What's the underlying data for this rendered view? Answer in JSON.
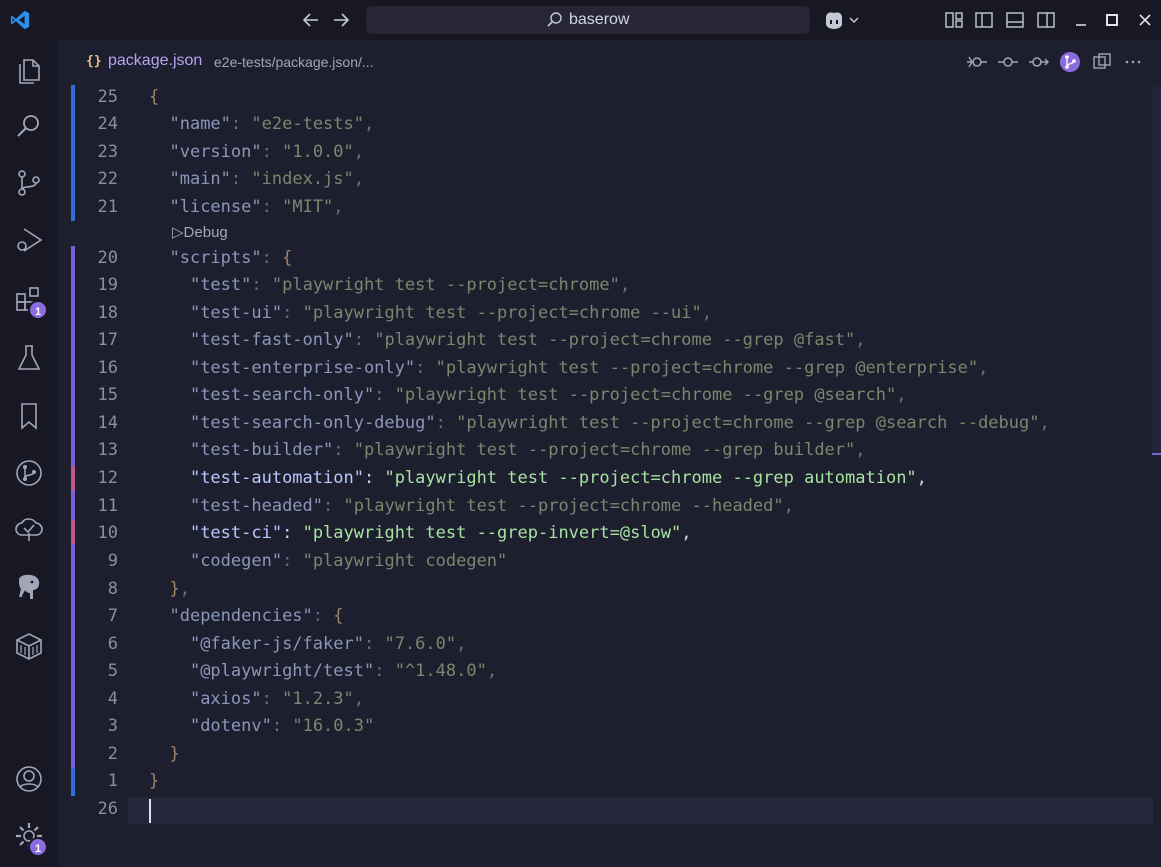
{
  "titlebar": {
    "search_text": "baserow"
  },
  "activity_bar": {
    "extensions_badge": "1",
    "settings_badge": "1"
  },
  "tab": {
    "icon_text": "{}",
    "filename": "package.json",
    "path": "e2e-tests/package.json/..."
  },
  "editor": {
    "codelens": "Debug",
    "lines": [
      {
        "n": "25",
        "t": "{"
      },
      {
        "n": "24",
        "t": "  \"name\": \"e2e-tests\","
      },
      {
        "n": "23",
        "t": "  \"version\": \"1.0.0\","
      },
      {
        "n": "22",
        "t": "  \"main\": \"index.js\","
      },
      {
        "n": "21",
        "t": "  \"license\": \"MIT\","
      },
      {
        "n": "20",
        "t": "  \"scripts\": {"
      },
      {
        "n": "19",
        "t": "    \"test\": \"playwright test --project=chrome\","
      },
      {
        "n": "18",
        "t": "    \"test-ui\": \"playwright test --project=chrome --ui\","
      },
      {
        "n": "17",
        "t": "    \"test-fast-only\": \"playwright test --project=chrome --grep @fast\","
      },
      {
        "n": "16",
        "t": "    \"test-enterprise-only\": \"playwright test --project=chrome --grep @enterprise\","
      },
      {
        "n": "15",
        "t": "    \"test-search-only\": \"playwright test --project=chrome --grep @search\","
      },
      {
        "n": "14",
        "t": "    \"test-search-only-debug\": \"playwright test --project=chrome --grep @search --debug\","
      },
      {
        "n": "13",
        "t": "    \"test-builder\": \"playwright test --project=chrome --grep builder\","
      },
      {
        "n": "12",
        "t": "    \"test-automation\": \"playwright test --project=chrome --grep automation\","
      },
      {
        "n": "11",
        "t": "    \"test-headed\": \"playwright test --project=chrome --headed\","
      },
      {
        "n": "10",
        "t": "    \"test-ci\": \"playwright test --grep-invert=@slow\","
      },
      {
        "n": "9",
        "t": "    \"codegen\": \"playwright codegen\""
      },
      {
        "n": "8",
        "t": "  },"
      },
      {
        "n": "7",
        "t": "  \"dependencies\": {"
      },
      {
        "n": "6",
        "t": "    \"@faker-js/faker\": \"7.6.0\","
      },
      {
        "n": "5",
        "t": "    \"@playwright/test\": \"^1.48.0\","
      },
      {
        "n": "4",
        "t": "    \"axios\": \"1.2.3\","
      },
      {
        "n": "3",
        "t": "    \"dotenv\": \"16.0.3\""
      },
      {
        "n": "2",
        "t": "  }"
      },
      {
        "n": "1",
        "t": "}"
      },
      {
        "n": "26",
        "t": ""
      }
    ]
  },
  "colors": {
    "background": "#1e1f2e",
    "sidebar": "#181825",
    "accent": "#8b6be0",
    "gutter_added": "#7c5fd6",
    "gutter_modified": "#c2578f",
    "gutter_blue": "#2f6fdc"
  }
}
